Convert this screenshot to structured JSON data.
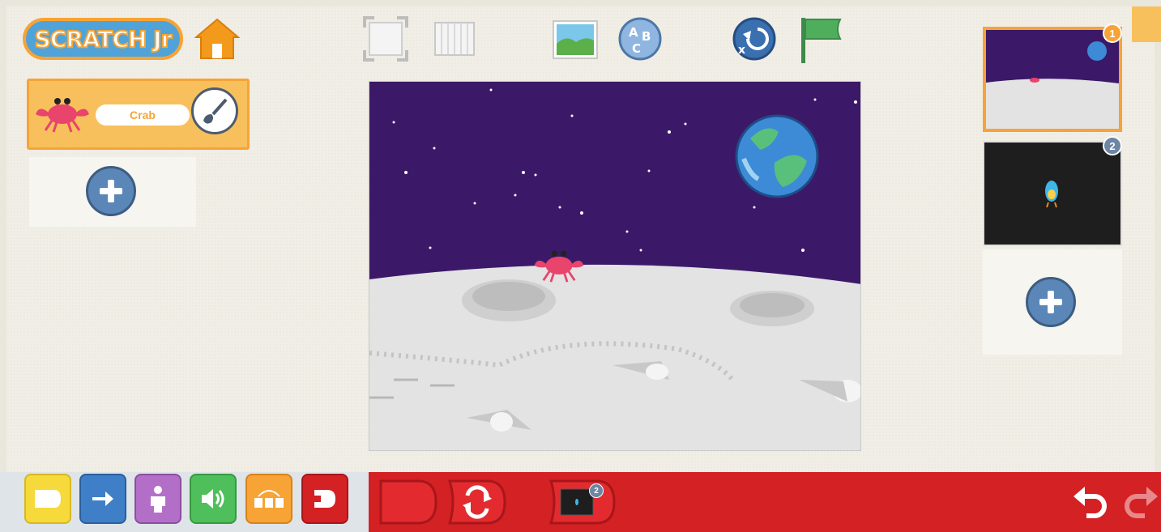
{
  "app": {
    "logo_text": "SCRATCH Jr"
  },
  "sprites": [
    {
      "name": "Crab",
      "selected": true
    }
  ],
  "toolbar": {
    "buttons": [
      "fullscreen-icon",
      "grid-icon",
      "background-icon",
      "text-icon",
      "reset-icon",
      "green-flag-icon"
    ]
  },
  "pages": [
    {
      "number": "1",
      "selected": true
    },
    {
      "number": "2",
      "selected": false
    }
  ],
  "categories": [
    "triggering",
    "motion",
    "looks",
    "sound",
    "control",
    "end"
  ],
  "script_blocks": [
    "start-on-flag-block",
    "repeat-forever-block",
    "go-to-page-block"
  ],
  "script_page_badge": "2",
  "colors": {
    "accent_orange": "#f7a335",
    "stage_sky": "#3c1968",
    "script_red": "#d42124",
    "motion_blue": "#3f7fc7",
    "looks_purple": "#b36fc7",
    "sound_green": "#4fbf5b"
  }
}
